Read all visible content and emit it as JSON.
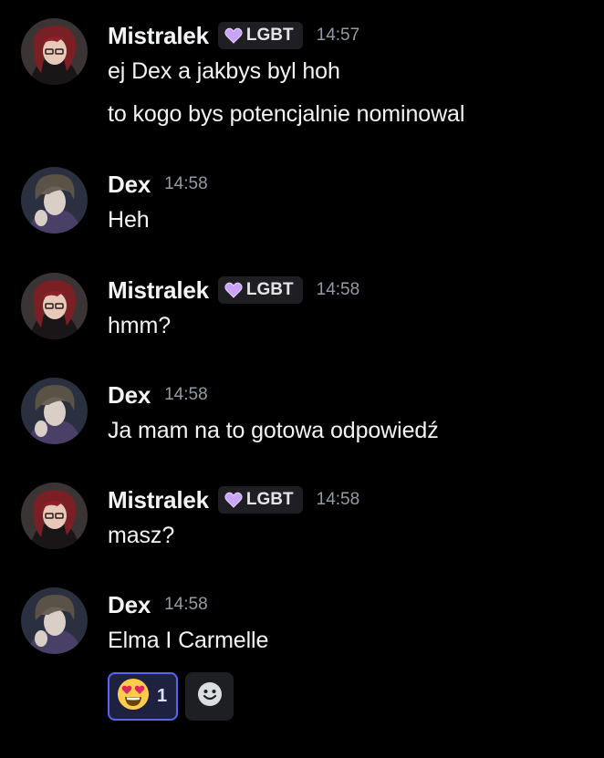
{
  "colors": {
    "background": "#000000",
    "author_text": "#f2f3f5",
    "timestamp_text": "#949ba4",
    "tag_background": "#1f1f23",
    "reaction_border": "#5865f2",
    "reaction_background": "#1e2140"
  },
  "messages": [
    {
      "author": "Mistralek",
      "tag": "LGBT",
      "tag_icon": "purple-heart-icon",
      "time": "14:57",
      "lines": [
        "ej Dex a jakbys byl hoh",
        "to kogo bys potencjalnie nominowal"
      ]
    },
    {
      "author": "Dex",
      "time": "14:58",
      "lines": [
        "Heh"
      ]
    },
    {
      "author": "Mistralek",
      "tag": "LGBT",
      "tag_icon": "purple-heart-icon",
      "time": "14:58",
      "lines": [
        "hmm?"
      ]
    },
    {
      "author": "Dex",
      "time": "14:58",
      "lines": [
        "Ja mam na to gotowa odpowiedź"
      ]
    },
    {
      "author": "Mistralek",
      "tag": "LGBT",
      "tag_icon": "purple-heart-icon",
      "time": "14:58",
      "lines": [
        "masz?"
      ]
    },
    {
      "author": "Dex",
      "time": "14:58",
      "lines": [
        "Elma I Carmelle"
      ]
    }
  ],
  "reactions": [
    {
      "emoji": "heart-eyes-emoji-icon",
      "count": "1"
    }
  ],
  "add_reaction_icon": "smiley-add-reaction-icon"
}
